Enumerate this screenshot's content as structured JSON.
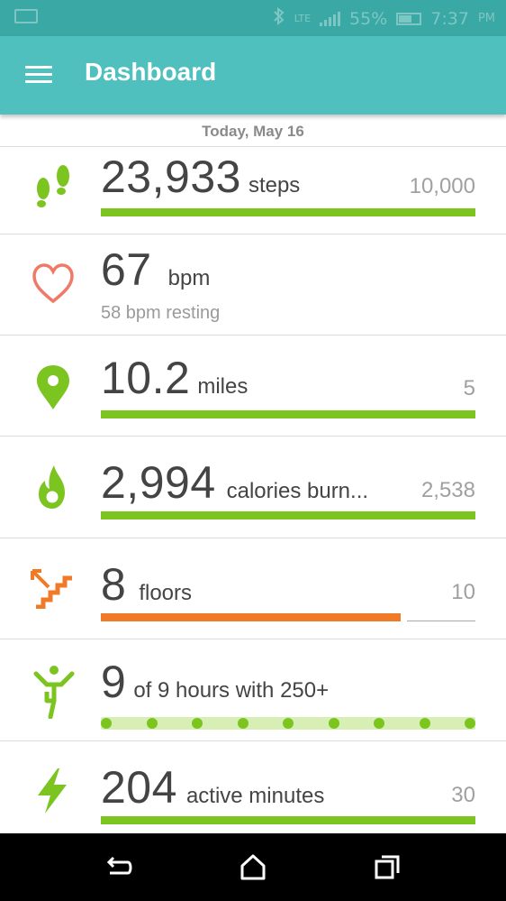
{
  "status_bar": {
    "battery": "55%",
    "time": "7:37",
    "ampm": "PM"
  },
  "app_bar": {
    "title": "Dashboard"
  },
  "date": "Today, May 16",
  "tiles": {
    "steps": {
      "value": "23,933",
      "unit": "steps",
      "goal": "10,000",
      "progress": 1.0
    },
    "heart": {
      "value": "67",
      "unit": "bpm",
      "sub": "58 bpm resting"
    },
    "distance": {
      "value": "10.2",
      "unit": "miles",
      "goal": "5",
      "progress": 1.0
    },
    "calories": {
      "value": "2,994",
      "unit": "calories burn...",
      "goal": "2,538",
      "progress": 1.0
    },
    "floors": {
      "value": "8",
      "unit": "floors",
      "goal": "10",
      "progress": 0.8
    },
    "hourly": {
      "value": "9",
      "unit": "of 9 hours with 250+",
      "hours_met": 9,
      "hours_total": 9
    },
    "active": {
      "value": "204",
      "unit": "active minutes",
      "goal": "30",
      "progress": 1.0
    }
  },
  "colors": {
    "teal": "#4fc0bd",
    "green": "#7cc420",
    "orange": "#f07a26",
    "heart": "#f07a68"
  },
  "icons": {
    "steps": "footprints-icon",
    "heart": "heart-icon",
    "distance": "location-pin-icon",
    "calories": "flame-icon",
    "floors": "stairs-icon",
    "hourly": "person-active-icon",
    "active": "lightning-icon"
  }
}
